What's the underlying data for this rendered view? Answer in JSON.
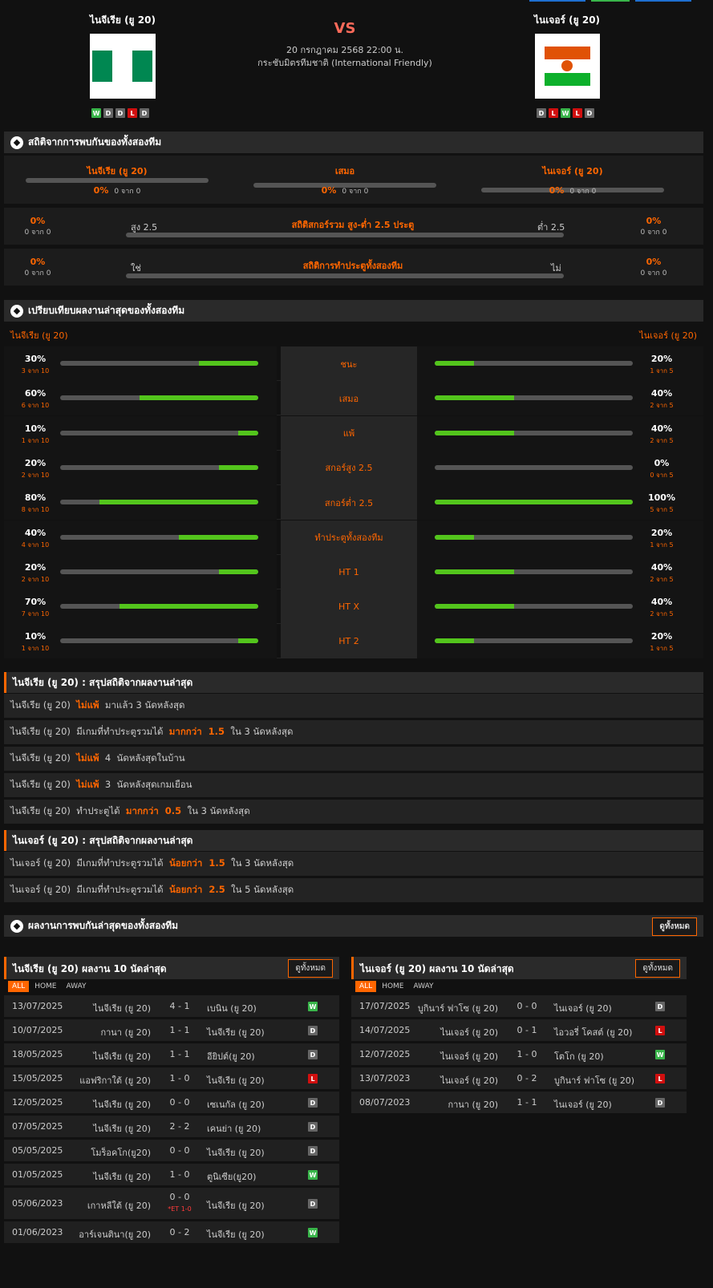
{
  "match": {
    "home_name": "ไนจีเรีย (ยู 20)",
    "away_name": "ไนเจอร์ (ยู 20)",
    "vs": "VS",
    "datetime": "20 กรกฎาคม 2568 22:00 น.",
    "competition": "กระชับมิตรทีมชาติ (International Friendly)",
    "home_form": [
      "W",
      "D",
      "D",
      "L",
      "D"
    ],
    "away_form": [
      "D",
      "L",
      "W",
      "L",
      "D"
    ]
  },
  "h2h": {
    "title": "สถิติจากการพบกันของทั้งสองทีม",
    "home_label": "ไนจีเรีย (ยู 20)",
    "draw_label": "เสมอ",
    "away_label": "ไนเจอร์ (ยู 20)",
    "home_pct": "0%",
    "home_sub": "0 จาก 0",
    "draw_pct": "0%",
    "draw_sub": "0 จาก 0",
    "away_pct": "0%",
    "away_sub": "0 จาก 0",
    "ou_title": "สถิติสกอร์รวม สูง-ต่ำ 2.5 ประตู",
    "ou_left_label": "สูง 2.5",
    "ou_right_label": "ต่ำ 2.5",
    "ou_left_pct": "0%",
    "ou_left_sub": "0 จาก 0",
    "ou_right_pct": "0%",
    "ou_right_sub": "0 จาก 0",
    "btts_title": "สถิติการทำประตูทั้งสองทีม",
    "btts_left_label": "ใช่",
    "btts_right_label": "ไม่",
    "btts_left_pct": "0%",
    "btts_left_sub": "0 จาก 0",
    "btts_right_pct": "0%",
    "btts_right_sub": "0 จาก 0"
  },
  "compare": {
    "title": "เปรียบเทียบผลงานล่าสุดของทั้งสองทีม",
    "home_name": "ไนจีเรีย (ยู 20)",
    "away_name": "ไนเจอร์ (ยู 20)",
    "rows": [
      {
        "label": "ชนะ",
        "hp": "30%",
        "hs": "3 จาก 10",
        "hv": 0.3,
        "ap": "20%",
        "as": "1 จาก 5",
        "av": 0.2
      },
      {
        "label": "เสมอ",
        "hp": "60%",
        "hs": "6 จาก 10",
        "hv": 0.6,
        "ap": "40%",
        "as": "2 จาก 5",
        "av": 0.4
      },
      {
        "label": "แพ้",
        "hp": "10%",
        "hs": "1 จาก 10",
        "hv": 0.1,
        "ap": "40%",
        "as": "2 จาก 5",
        "av": 0.4
      },
      {
        "label": "สกอร์สูง 2.5",
        "hp": "20%",
        "hs": "2 จาก 10",
        "hv": 0.2,
        "ap": "0%",
        "as": "0 จาก 5",
        "av": 0
      },
      {
        "label": "สกอร์ต่ำ 2.5",
        "hp": "80%",
        "hs": "8 จาก 10",
        "hv": 0.8,
        "ap": "100%",
        "as": "5 จาก 5",
        "av": 1
      },
      {
        "label": "ทำประตูทั้งสองทีม",
        "hp": "40%",
        "hs": "4 จาก 10",
        "hv": 0.4,
        "ap": "20%",
        "as": "1 จาก 5",
        "av": 0.2
      },
      {
        "label": "HT 1",
        "hp": "20%",
        "hs": "2 จาก 10",
        "hv": 0.2,
        "ap": "40%",
        "as": "2 จาก 5",
        "av": 0.4
      },
      {
        "label": "HT X",
        "hp": "70%",
        "hs": "7 จาก 10",
        "hv": 0.7,
        "ap": "40%",
        "as": "2 จาก 5",
        "av": 0.4
      },
      {
        "label": "HT 2",
        "hp": "10%",
        "hs": "1 จาก 10",
        "hv": 0.1,
        "ap": "20%",
        "as": "1 จาก 5",
        "av": 0.2
      }
    ]
  },
  "summary_home": {
    "title": "ไนจีเรีย (ยู 20) : สรุปสถิติจากผลงานล่าสุด",
    "rows": [
      {
        "a": "ไนจีเรีย (ยู 20)  ",
        "h": "ไม่แพ้",
        "b": "  มาแล้ว 3 นัดหลังสุด"
      },
      {
        "a": "ไนจีเรีย (ยู 20)  มีเกมที่ทำประตูรวมได้  ",
        "h": "มากกว่า  1.5",
        "b": "  ใน 3 นัดหลังสุด"
      },
      {
        "a": "ไนจีเรีย (ยู 20)  ",
        "h": "ไม่แพ้",
        "b": "  4  นัดหลังสุดในบ้าน"
      },
      {
        "a": "ไนจีเรีย (ยู 20)  ",
        "h": "ไม่แพ้",
        "b": "  3  นัดหลังสุดเกมเยือน"
      },
      {
        "a": "ไนจีเรีย (ยู 20)  ทำประตูได้  ",
        "h": "มากกว่า  0.5",
        "b": "  ใน 3 นัดหลังสุด"
      }
    ]
  },
  "summary_away": {
    "title": "ไนเจอร์ (ยู 20) : สรุปสถิติจากผลงานล่าสุด",
    "rows": [
      {
        "a": "ไนเจอร์ (ยู 20)  มีเกมที่ทำประตูรวมได้  ",
        "h": "น้อยกว่า  1.5",
        "b": "  ใน 3 นัดหลังสุด"
      },
      {
        "a": "ไนเจอร์ (ยู 20)  มีเกมที่ทำประตูรวมได้  ",
        "h": "น้อยกว่า  2.5",
        "b": "  ใน 5 นัดหลังสุด"
      }
    ]
  },
  "recent_h2h": {
    "title": "ผลงานการพบกันล่าสุดของทั้งสองทีม",
    "view_all": "ดูทั้งหมด"
  },
  "tabs": [
    "ALL",
    "HOME",
    "AWAY"
  ],
  "home_recent": {
    "title": "ไนจีเรีย (ยู 20) ผลงาน 10 นัดล่าสุด",
    "view_all": "ดูทั้งหมด",
    "matches": [
      {
        "date": "13/07/2025",
        "home": "ไนจีเรีย (ยู 20)",
        "score": "4 - 1",
        "away": "เบนิน (ยู 20)",
        "res": "W",
        "note": ""
      },
      {
        "date": "10/07/2025",
        "home": "กานา (ยู 20)",
        "score": "1 - 1",
        "away": "ไนจีเรีย (ยู 20)",
        "res": "D",
        "note": ""
      },
      {
        "date": "18/05/2025",
        "home": "ไนจีเรีย (ยู 20)",
        "score": "1 - 1",
        "away": "อียิปต์(ยู 20)",
        "res": "D",
        "note": ""
      },
      {
        "date": "15/05/2025",
        "home": "แอฟริกาใต้ (ยู 20)",
        "score": "1 - 0",
        "away": "ไนจีเรีย (ยู 20)",
        "res": "L",
        "note": ""
      },
      {
        "date": "12/05/2025",
        "home": "ไนจีเรีย (ยู 20)",
        "score": "0 - 0",
        "away": "เซเนกัล (ยู 20)",
        "res": "D",
        "note": ""
      },
      {
        "date": "07/05/2025",
        "home": "ไนจีเรีย (ยู 20)",
        "score": "2 - 2",
        "away": "เคนย่า (ยู 20)",
        "res": "D",
        "note": ""
      },
      {
        "date": "05/05/2025",
        "home": "โมร็อคโก(ยู20)",
        "score": "0 - 0",
        "away": "ไนจีเรีย (ยู 20)",
        "res": "D",
        "note": ""
      },
      {
        "date": "01/05/2025",
        "home": "ไนจีเรีย (ยู 20)",
        "score": "1 - 0",
        "away": "ตูนิเซีย(ยู20)",
        "res": "W",
        "note": ""
      },
      {
        "date": "05/06/2023",
        "home": "เกาหลีใต้ (ยู 20)",
        "score": "0 - 0",
        "away": "ไนจีเรีย (ยู 20)",
        "res": "D",
        "note": "*ET 1-0"
      },
      {
        "date": "01/06/2023",
        "home": "อาร์เจนตินา(ยู 20)",
        "score": "0 - 2",
        "away": "ไนจีเรีย (ยู 20)",
        "res": "W",
        "note": ""
      }
    ]
  },
  "away_recent": {
    "title": "ไนเจอร์ (ยู 20) ผลงาน 10 นัดล่าสุด",
    "view_all": "ดูทั้งหมด",
    "matches": [
      {
        "date": "17/07/2025",
        "home": "บูกินาร์ ฟาโซ (ยู 20)",
        "score": "0 - 0",
        "away": "ไนเจอร์ (ยู 20)",
        "res": "D"
      },
      {
        "date": "14/07/2025",
        "home": "ไนเจอร์ (ยู 20)",
        "score": "0 - 1",
        "away": "ไอวอรี่ โคสต์ (ยู 20)",
        "res": "L"
      },
      {
        "date": "12/07/2025",
        "home": "ไนเจอร์ (ยู 20)",
        "score": "1 - 0",
        "away": "โตโก (ยู 20)",
        "res": "W"
      },
      {
        "date": "13/07/2023",
        "home": "ไนเจอร์ (ยู 20)",
        "score": "0 - 2",
        "away": "บูกินาร์ ฟาโซ (ยู 20)",
        "res": "L"
      },
      {
        "date": "08/07/2023",
        "home": "กานา (ยู 20)",
        "score": "1 - 1",
        "away": "ไนเจอร์ (ยู 20)",
        "res": "D"
      }
    ]
  },
  "colors": {
    "accent": "#ff6600",
    "green": "#53c51c",
    "win": "#39b54a",
    "loss": "#d10f0f",
    "draw": "#666666"
  }
}
